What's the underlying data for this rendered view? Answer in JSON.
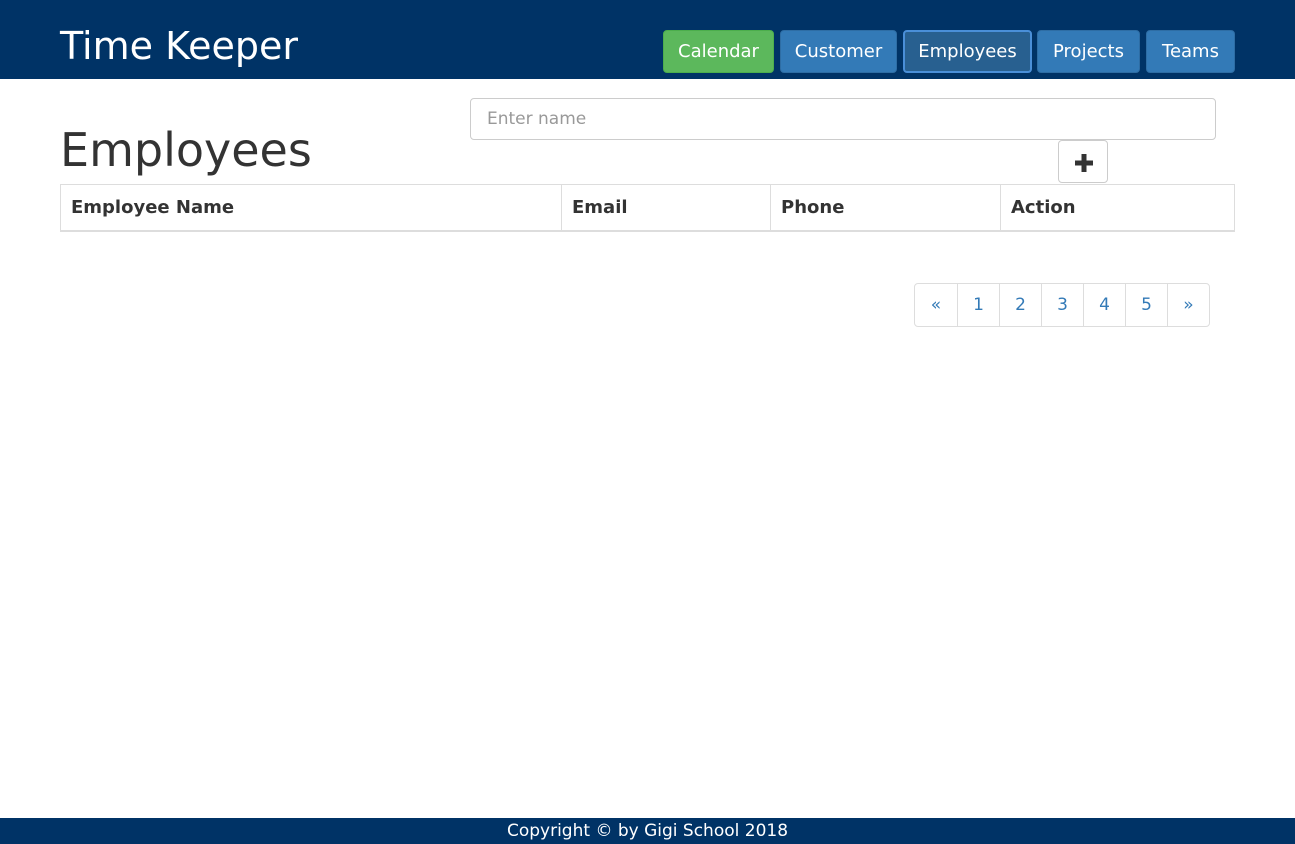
{
  "app": {
    "title": "Time Keeper"
  },
  "nav": {
    "items": [
      {
        "label": "Calendar"
      },
      {
        "label": "Customer"
      },
      {
        "label": "Employees",
        "active": true
      },
      {
        "label": "Projects"
      },
      {
        "label": "Teams"
      }
    ]
  },
  "search": {
    "placeholder": "Enter name",
    "value": ""
  },
  "page": {
    "title": "Employees"
  },
  "actions": {
    "add_icon": "plus-icon"
  },
  "table": {
    "columns": [
      "Employee Name",
      "Email",
      "Phone",
      "Action"
    ],
    "rows": []
  },
  "pagination": {
    "prev": "«",
    "pages": [
      "1",
      "2",
      "3",
      "4",
      "5"
    ],
    "next": "»"
  },
  "footer": {
    "text": "Copyright © by Gigi School 2018"
  },
  "colors": {
    "header_bg": "#003366",
    "primary": "#337ab7",
    "success": "#5cb85c",
    "active": "#286090"
  }
}
